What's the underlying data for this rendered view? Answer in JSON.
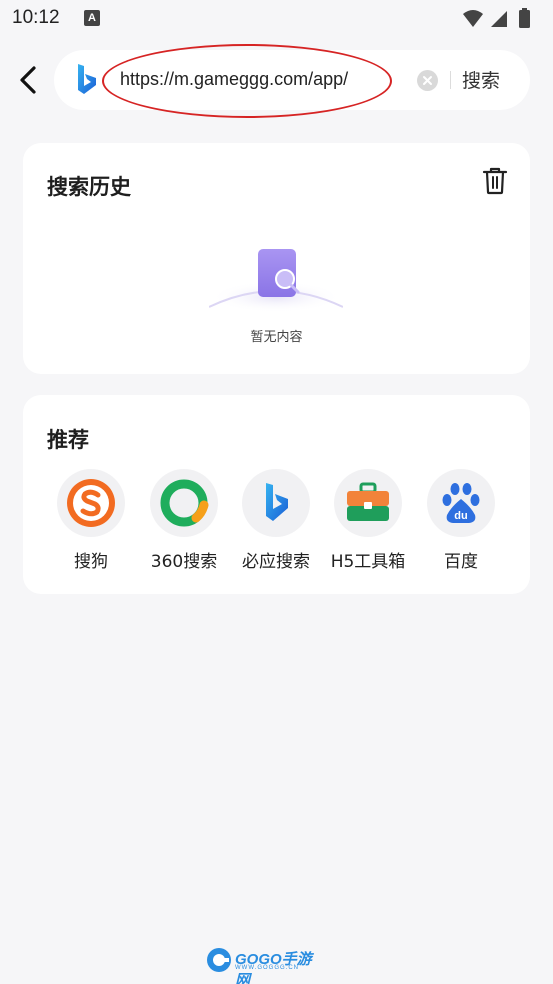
{
  "status_bar": {
    "time": "10:12",
    "notification_letter": "A",
    "icons": [
      "wifi-icon",
      "signal-icon",
      "battery-icon"
    ]
  },
  "search_bar": {
    "url": "https://m.gameggg.com/app/",
    "search_label": "搜索",
    "engine_icon": "bing-icon"
  },
  "history": {
    "title": "搜索历史",
    "empty_text": "暂无内容"
  },
  "recommend": {
    "title": "推荐",
    "items": [
      {
        "label": "搜狗",
        "icon": "sogou-icon"
      },
      {
        "label": "360搜索",
        "icon": "360-search-icon"
      },
      {
        "label": "必应搜索",
        "icon": "bing-icon"
      },
      {
        "label": "H5工具箱",
        "icon": "toolbox-icon"
      },
      {
        "label": "百度",
        "icon": "baidu-icon"
      }
    ]
  },
  "watermark": {
    "brand": "GOGO手游网",
    "domain": "WWW.GOGGG.CN"
  },
  "colors": {
    "background": "#f6f6f8",
    "card": "#ffffff",
    "annotation": "#d62424",
    "sogou": "#f26b21",
    "qihoo_green": "#1fad5c",
    "qihoo_orange": "#f6a01a",
    "toolbox": "#1f9e5b",
    "baidu": "#2e6fdf"
  }
}
